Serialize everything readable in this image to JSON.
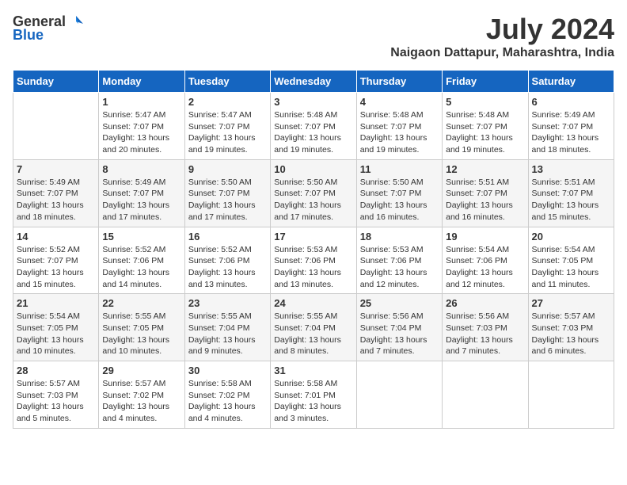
{
  "header": {
    "logo_general": "General",
    "logo_blue": "Blue",
    "month_title": "July 2024",
    "location": "Naigaon Dattapur, Maharashtra, India"
  },
  "days_of_week": [
    "Sunday",
    "Monday",
    "Tuesday",
    "Wednesday",
    "Thursday",
    "Friday",
    "Saturday"
  ],
  "weeks": [
    [
      {
        "day": "",
        "info": ""
      },
      {
        "day": "1",
        "info": "Sunrise: 5:47 AM\nSunset: 7:07 PM\nDaylight: 13 hours\nand 20 minutes."
      },
      {
        "day": "2",
        "info": "Sunrise: 5:47 AM\nSunset: 7:07 PM\nDaylight: 13 hours\nand 19 minutes."
      },
      {
        "day": "3",
        "info": "Sunrise: 5:48 AM\nSunset: 7:07 PM\nDaylight: 13 hours\nand 19 minutes."
      },
      {
        "day": "4",
        "info": "Sunrise: 5:48 AM\nSunset: 7:07 PM\nDaylight: 13 hours\nand 19 minutes."
      },
      {
        "day": "5",
        "info": "Sunrise: 5:48 AM\nSunset: 7:07 PM\nDaylight: 13 hours\nand 19 minutes."
      },
      {
        "day": "6",
        "info": "Sunrise: 5:49 AM\nSunset: 7:07 PM\nDaylight: 13 hours\nand 18 minutes."
      }
    ],
    [
      {
        "day": "7",
        "info": "Sunrise: 5:49 AM\nSunset: 7:07 PM\nDaylight: 13 hours\nand 18 minutes."
      },
      {
        "day": "8",
        "info": "Sunrise: 5:49 AM\nSunset: 7:07 PM\nDaylight: 13 hours\nand 17 minutes."
      },
      {
        "day": "9",
        "info": "Sunrise: 5:50 AM\nSunset: 7:07 PM\nDaylight: 13 hours\nand 17 minutes."
      },
      {
        "day": "10",
        "info": "Sunrise: 5:50 AM\nSunset: 7:07 PM\nDaylight: 13 hours\nand 17 minutes."
      },
      {
        "day": "11",
        "info": "Sunrise: 5:50 AM\nSunset: 7:07 PM\nDaylight: 13 hours\nand 16 minutes."
      },
      {
        "day": "12",
        "info": "Sunrise: 5:51 AM\nSunset: 7:07 PM\nDaylight: 13 hours\nand 16 minutes."
      },
      {
        "day": "13",
        "info": "Sunrise: 5:51 AM\nSunset: 7:07 PM\nDaylight: 13 hours\nand 15 minutes."
      }
    ],
    [
      {
        "day": "14",
        "info": "Sunrise: 5:52 AM\nSunset: 7:07 PM\nDaylight: 13 hours\nand 15 minutes."
      },
      {
        "day": "15",
        "info": "Sunrise: 5:52 AM\nSunset: 7:06 PM\nDaylight: 13 hours\nand 14 minutes."
      },
      {
        "day": "16",
        "info": "Sunrise: 5:52 AM\nSunset: 7:06 PM\nDaylight: 13 hours\nand 13 minutes."
      },
      {
        "day": "17",
        "info": "Sunrise: 5:53 AM\nSunset: 7:06 PM\nDaylight: 13 hours\nand 13 minutes."
      },
      {
        "day": "18",
        "info": "Sunrise: 5:53 AM\nSunset: 7:06 PM\nDaylight: 13 hours\nand 12 minutes."
      },
      {
        "day": "19",
        "info": "Sunrise: 5:54 AM\nSunset: 7:06 PM\nDaylight: 13 hours\nand 12 minutes."
      },
      {
        "day": "20",
        "info": "Sunrise: 5:54 AM\nSunset: 7:05 PM\nDaylight: 13 hours\nand 11 minutes."
      }
    ],
    [
      {
        "day": "21",
        "info": "Sunrise: 5:54 AM\nSunset: 7:05 PM\nDaylight: 13 hours\nand 10 minutes."
      },
      {
        "day": "22",
        "info": "Sunrise: 5:55 AM\nSunset: 7:05 PM\nDaylight: 13 hours\nand 10 minutes."
      },
      {
        "day": "23",
        "info": "Sunrise: 5:55 AM\nSunset: 7:04 PM\nDaylight: 13 hours\nand 9 minutes."
      },
      {
        "day": "24",
        "info": "Sunrise: 5:55 AM\nSunset: 7:04 PM\nDaylight: 13 hours\nand 8 minutes."
      },
      {
        "day": "25",
        "info": "Sunrise: 5:56 AM\nSunset: 7:04 PM\nDaylight: 13 hours\nand 7 minutes."
      },
      {
        "day": "26",
        "info": "Sunrise: 5:56 AM\nSunset: 7:03 PM\nDaylight: 13 hours\nand 7 minutes."
      },
      {
        "day": "27",
        "info": "Sunrise: 5:57 AM\nSunset: 7:03 PM\nDaylight: 13 hours\nand 6 minutes."
      }
    ],
    [
      {
        "day": "28",
        "info": "Sunrise: 5:57 AM\nSunset: 7:03 PM\nDaylight: 13 hours\nand 5 minutes."
      },
      {
        "day": "29",
        "info": "Sunrise: 5:57 AM\nSunset: 7:02 PM\nDaylight: 13 hours\nand 4 minutes."
      },
      {
        "day": "30",
        "info": "Sunrise: 5:58 AM\nSunset: 7:02 PM\nDaylight: 13 hours\nand 4 minutes."
      },
      {
        "day": "31",
        "info": "Sunrise: 5:58 AM\nSunset: 7:01 PM\nDaylight: 13 hours\nand 3 minutes."
      },
      {
        "day": "",
        "info": ""
      },
      {
        "day": "",
        "info": ""
      },
      {
        "day": "",
        "info": ""
      }
    ]
  ]
}
